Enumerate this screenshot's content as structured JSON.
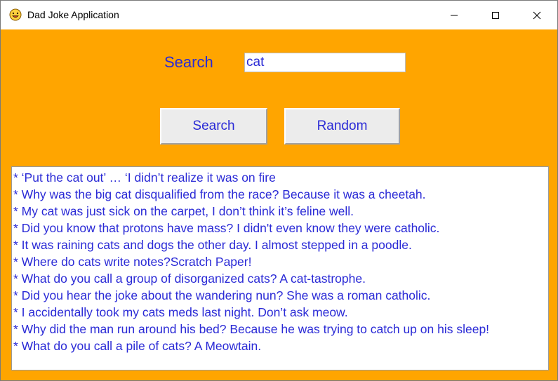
{
  "window": {
    "title": "Dad Joke Application",
    "icon": "smiley-face-icon"
  },
  "controls": {
    "minimize": "minimize-icon",
    "maximize": "maximize-icon",
    "close": "close-icon"
  },
  "search": {
    "label": "Search",
    "value": "cat"
  },
  "buttons": {
    "search_label": "Search",
    "random_label": "Random"
  },
  "results": [
    "* ‘Put the cat out’ … ‘I didn’t realize it was on fire",
    "* Why was the big cat disqualified from the race? Because it was a cheetah.",
    "* My cat was just sick on the carpet, I don’t think it’s feline well.",
    "* Did you know that protons have mass? I didn't even know they were catholic.",
    "* It was raining cats and dogs the other day. I almost stepped in a poodle.",
    "* Where do cats write notes?Scratch Paper!",
    "* What do you call a group of disorganized cats? A cat-tastrophe.",
    "* Did you hear the joke about the wandering nun? She was a roman catholic.",
    "* I accidentally took my cats meds last night. Don’t ask meow.",
    "* Why did the man run around his bed? Because he was trying to catch up on his sleep!",
    "* What do you call a pile of cats?  A Meowtain."
  ],
  "colors": {
    "background": "#ffa500",
    "text": "#2a2ad6",
    "button": "#ececec"
  }
}
